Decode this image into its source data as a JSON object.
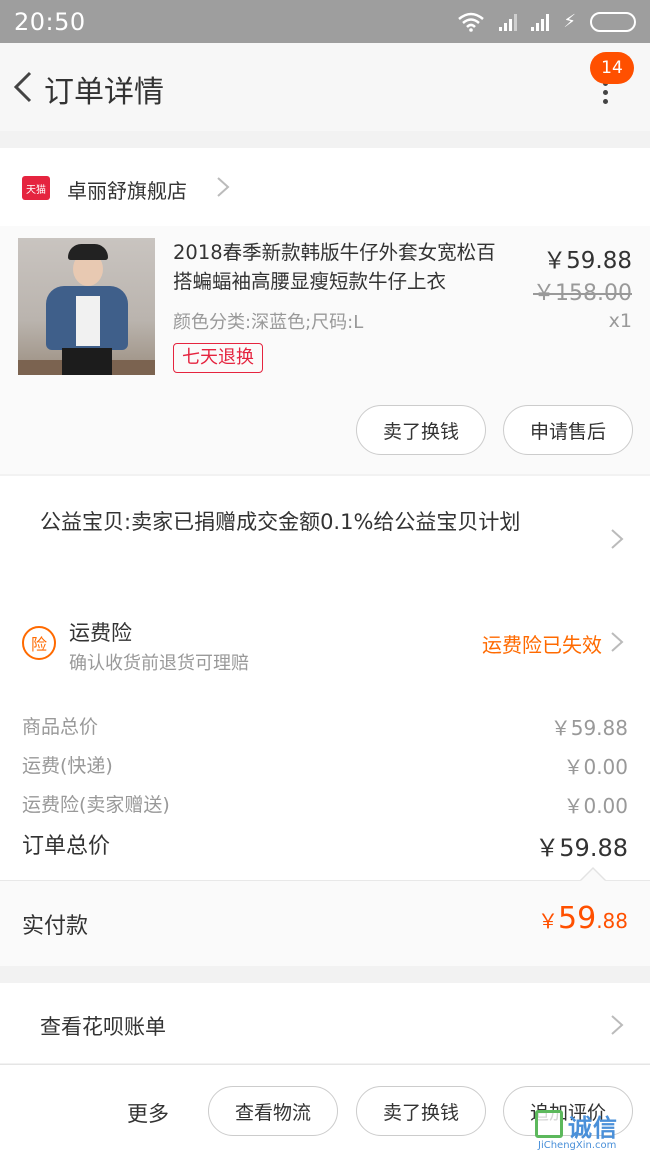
{
  "status_bar": {
    "time": "20:50"
  },
  "header": {
    "title": "订单详情",
    "badge_count": "14"
  },
  "store": {
    "logo_text": "天猫",
    "name": "卓丽舒旗舰店"
  },
  "product": {
    "title": "2018春季新款韩版牛仔外套女宽松百搭蝙蝠袖高腰显瘦短款牛仔上衣",
    "sku": "颜色分类:深蓝色;尺码:L",
    "tag": "七天退换",
    "price": "￥59.88",
    "original_price": "￥158.00",
    "quantity": "x1",
    "actions": {
      "sell": "卖了换钱",
      "after_sale": "申请售后"
    }
  },
  "charity": {
    "text": "公益宝贝:卖家已捐赠成交金额0.1%给公益宝贝计划"
  },
  "insurance": {
    "icon_text": "险",
    "title": "运费险",
    "subtitle": "确认收货前退货可理赔",
    "status": "运费险已失效",
    "accent": "#ff6a00"
  },
  "summary": {
    "rows": [
      {
        "label": "商品总价",
        "value": "￥59.88"
      },
      {
        "label": "运费(快递)",
        "value": "￥0.00"
      },
      {
        "label": "运费险(卖家赠送)",
        "value": "￥0.00"
      }
    ],
    "total_label": "订单总价",
    "total_value": "￥59.88"
  },
  "payment": {
    "label": "实付款",
    "currency": "￥",
    "integer": "59",
    "decimal": ".88",
    "accent": "#ff5000"
  },
  "huabei": {
    "label": "查看花呗账单"
  },
  "bottom_bar": {
    "more": "更多",
    "buttons": [
      "查看物流",
      "卖了换钱",
      "追加评价"
    ]
  },
  "watermark": {
    "text": "诚信",
    "sub": "JiChengXin.com"
  }
}
